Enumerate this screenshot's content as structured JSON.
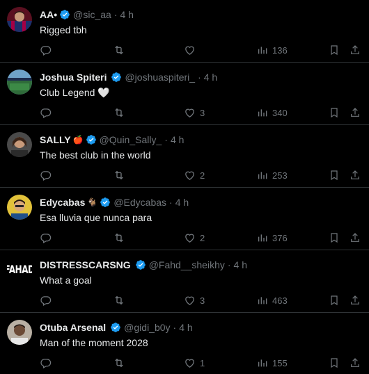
{
  "tweets": [
    {
      "name": "AA",
      "name_suffix": "•",
      "handle": "@sic_aa",
      "time": "4 h",
      "text": "Rigged tbh",
      "replies": "",
      "retweets": "",
      "likes": "",
      "views": "136",
      "avatar_icon": "player-avatar-icon"
    },
    {
      "name": "Joshua Spiteri",
      "name_suffix": "",
      "handle": "@joshuaspiteri_",
      "time": "4 h",
      "text": "Club Legend 🤍",
      "replies": "",
      "retweets": "",
      "likes": "3",
      "views": "340",
      "avatar_icon": "stadium-avatar-icon"
    },
    {
      "name": "SALLY",
      "name_suffix": "🍎",
      "handle": "@Quin_Sally_",
      "time": "4 h",
      "text": "The best club in the world",
      "replies": "",
      "retweets": "",
      "likes": "2",
      "views": "253",
      "avatar_icon": "person-avatar-icon"
    },
    {
      "name": "Edycabas",
      "name_suffix": "🐐",
      "handle": "@Edycabas",
      "time": "4 h",
      "text": "Esa lluvia que nunca para",
      "replies": "",
      "retweets": "",
      "likes": "2",
      "views": "376",
      "avatar_icon": "cartoon-avatar-icon"
    },
    {
      "name": "DISTRESSCARSNG",
      "name_suffix": "",
      "handle": "@Fahd__sheikhy",
      "time": "4 h",
      "text": "What a goal",
      "replies": "",
      "retweets": "",
      "likes": "3",
      "views": "463",
      "avatar_text": "FAHAD"
    },
    {
      "name": "Otuba Arsenal",
      "name_suffix": "",
      "handle": "@gidi_b0y",
      "time": "4 h",
      "text": "Man of the moment 2028",
      "replies": "",
      "retweets": "",
      "likes": "1",
      "views": "155",
      "avatar_icon": "person-avatar-icon"
    }
  ],
  "colors": {
    "background": "#000000",
    "text": "#e7e9ea",
    "muted": "#71767b",
    "verified": "#1d9bf0",
    "divider": "#2f3336"
  }
}
